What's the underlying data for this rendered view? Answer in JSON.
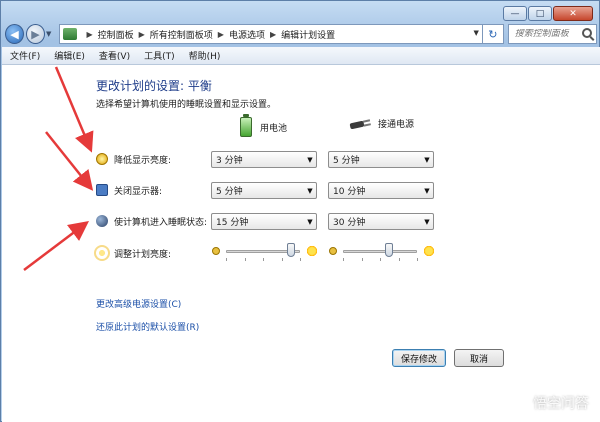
{
  "window": {
    "caption": {
      "minimize": "—",
      "maximize": "□",
      "close": "✕"
    }
  },
  "address_bar": {
    "breadcrumbs": [
      "控制面板",
      "所有控制面板项",
      "电源选项",
      "编辑计划设置"
    ],
    "search_placeholder": "搜索控制面板"
  },
  "menu": [
    "文件(F)",
    "编辑(E)",
    "查看(V)",
    "工具(T)",
    "帮助(H)"
  ],
  "main": {
    "title": "更改计划的设置: 平衡",
    "subtitle": "选择希望计算机使用的睡眠设置和显示设置。",
    "columns": {
      "battery": "用电池",
      "plugged": "接通电源"
    },
    "rows": [
      {
        "label": "降低显示亮度:",
        "battery": "3 分钟",
        "plugged": "5 分钟"
      },
      {
        "label": "关闭显示器:",
        "battery": "5 分钟",
        "plugged": "10 分钟"
      },
      {
        "label": "使计算机进入睡眠状态:",
        "battery": "15 分钟",
        "plugged": "30 分钟"
      }
    ],
    "brightness": {
      "label": "调整计划亮度:",
      "battery_level": 0.88,
      "plugged_level": 0.62
    },
    "links": {
      "advanced": "更改高级电源设置(C)",
      "restore": "还原此计划的默认设置(R)"
    },
    "buttons": {
      "save": "保存修改",
      "cancel": "取消"
    }
  },
  "watermark": "悟空问答",
  "colors": {
    "title": "#1f3d8a",
    "link": "#1c50a8",
    "annotation_arrow": "#e53a3a"
  }
}
